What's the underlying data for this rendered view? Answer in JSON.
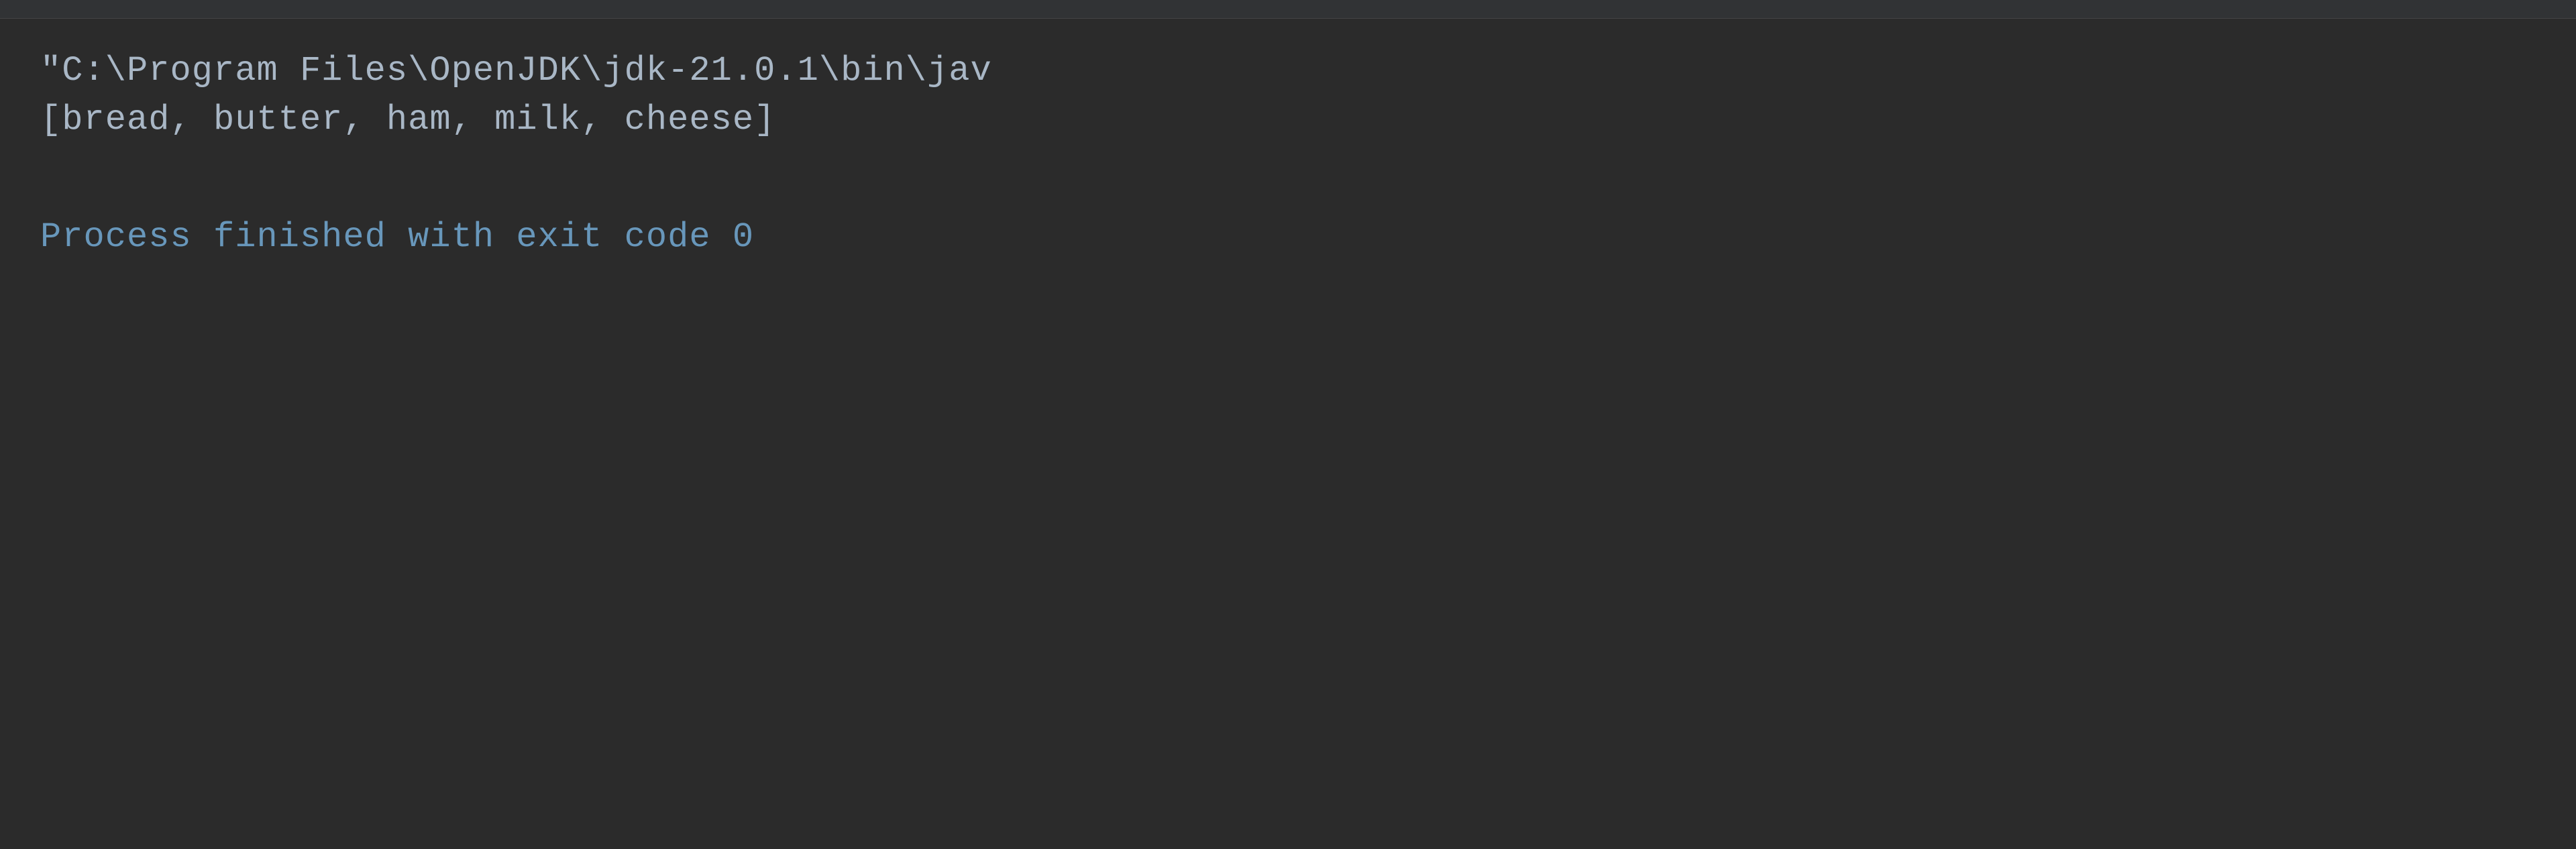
{
  "terminal": {
    "background_color": "#2b2b2b",
    "lines": [
      {
        "id": "command-line",
        "type": "command",
        "text": "\"C:\\Program Files\\OpenJDK\\jdk-21.0.1\\bin\\jav"
      },
      {
        "id": "output-line",
        "type": "output",
        "text": "[bread, butter, ham, milk, cheese]"
      },
      {
        "id": "empty-line-1",
        "type": "empty",
        "text": ""
      },
      {
        "id": "process-line",
        "type": "process",
        "text": "Process finished with exit code 0"
      }
    ]
  }
}
